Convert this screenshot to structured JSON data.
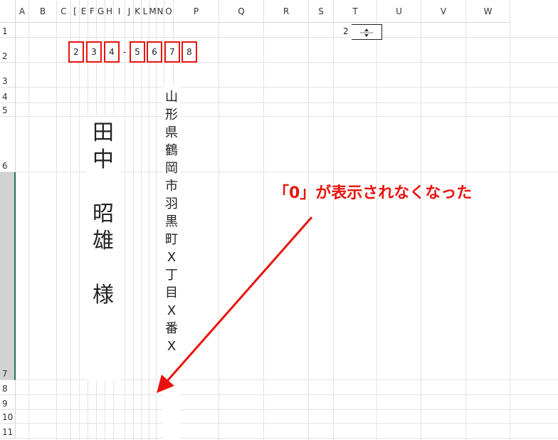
{
  "columns": [
    "A",
    "B",
    "C",
    "D",
    "E",
    "F",
    "G",
    "H",
    "I",
    "J",
    "K",
    "L",
    "M",
    "N",
    "O",
    "P",
    "Q",
    "R",
    "S",
    "T",
    "U",
    "V",
    "W"
  ],
  "column_header_labels": [
    "A",
    "B",
    "C",
    "[",
    "E",
    "F",
    "G",
    "H",
    "I",
    "J",
    "K",
    "L",
    "M",
    "N",
    "O",
    "P",
    "Q",
    "R",
    "S",
    "T",
    "U",
    "V",
    "W"
  ],
  "rows": [
    "1",
    "2",
    "3",
    "4",
    "5",
    "6",
    "7",
    "8",
    "9",
    "10",
    "11"
  ],
  "selected_row": "7",
  "spinner": {
    "value": "2"
  },
  "postal_code": {
    "digits": [
      "2",
      "3",
      "4",
      "5",
      "6",
      "7",
      "8"
    ],
    "separator": "-"
  },
  "recipient": {
    "name_chars": [
      "田",
      "中",
      "",
      "昭",
      "雄",
      "",
      "様"
    ]
  },
  "address": {
    "chars": [
      "山",
      "形",
      "県",
      "鶴",
      "岡",
      "市",
      "羽",
      "黒",
      "町",
      "X",
      "丁",
      "目",
      "X",
      "番",
      "X"
    ]
  },
  "annotation": {
    "text": "「0」が表示されなくなった",
    "color": "#e8130e"
  },
  "colors": {
    "accent_red": "#e8130e",
    "selected_row_bar": "#217346",
    "gridline": "#e4e4e4"
  }
}
